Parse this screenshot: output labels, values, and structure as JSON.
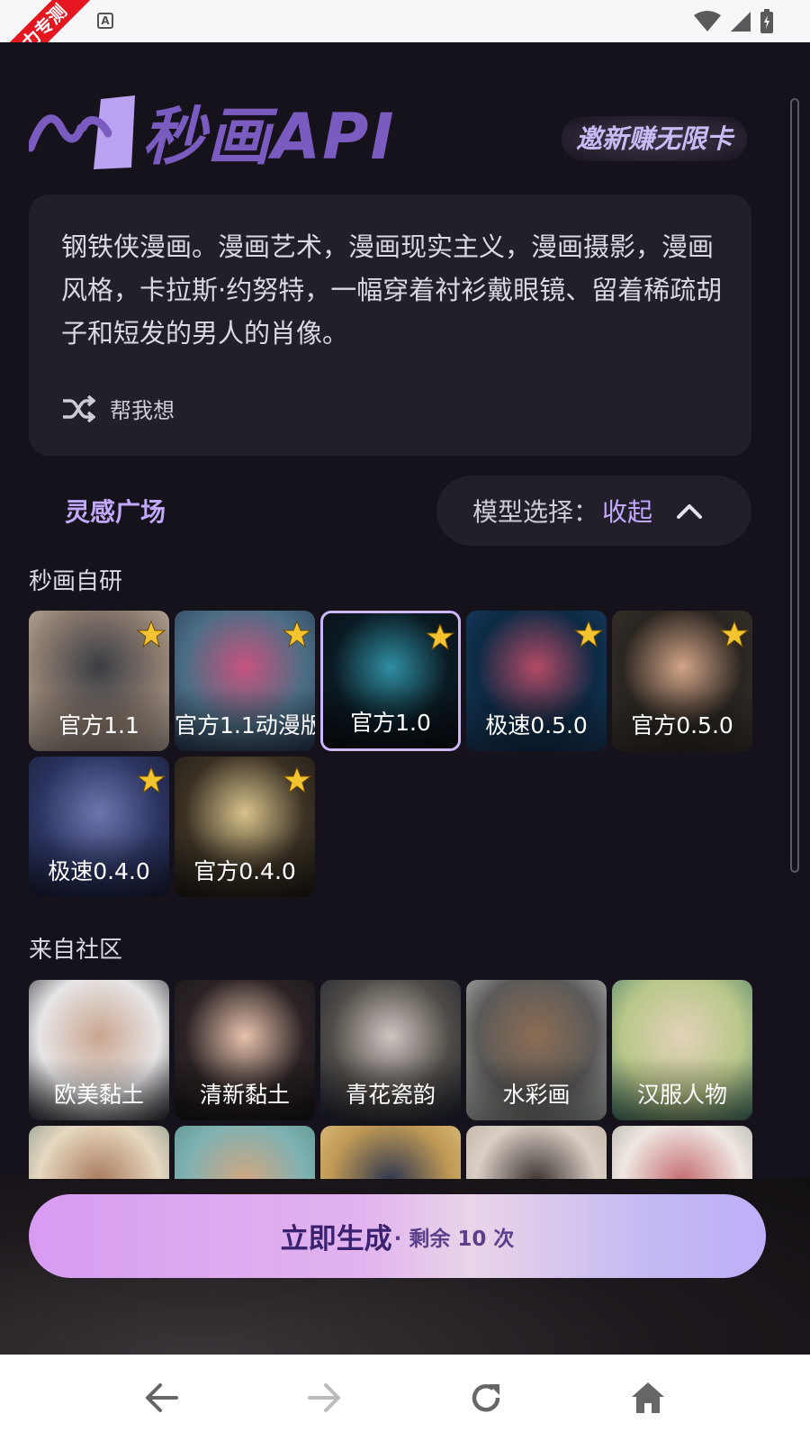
{
  "status_bar": {
    "ribbon": "圣力专测",
    "a_icon": "A"
  },
  "header": {
    "logo_text": "秒画API",
    "invite_label": "邀新赚无限卡"
  },
  "prompt": {
    "text": "钢铁侠漫画。漫画艺术，漫画现实主义，漫画摄影，漫画风格，卡拉斯·约努特，一幅穿着衬衫戴眼镜、留着稀疏胡子和短发的男人的肖像。",
    "help_label": "帮我想"
  },
  "inspiration_label": "灵感广场",
  "model_select": {
    "label": "模型选择：",
    "value": "收起"
  },
  "sections": {
    "official_title": "秒画自研",
    "community_title": "来自社区"
  },
  "official_models": [
    {
      "name": "官方1.1",
      "starred": true,
      "selected": false,
      "colors": [
        "#8a7a6e",
        "#3a3d44",
        "#c7b9a9"
      ]
    },
    {
      "name": "官方1.1动漫版",
      "starred": true,
      "selected": false,
      "colors": [
        "#4b6e85",
        "#c7537e",
        "#2b3a55"
      ]
    },
    {
      "name": "官方1.0",
      "starred": true,
      "selected": true,
      "colors": [
        "#0a1a22",
        "#2f8ea3",
        "#0d0d12"
      ]
    },
    {
      "name": "极速0.5.0",
      "starred": true,
      "selected": false,
      "colors": [
        "#0d2a45",
        "#b34a64",
        "#1a3f63"
      ]
    },
    {
      "name": "官方0.5.0",
      "starred": true,
      "selected": false,
      "colors": [
        "#2a2520",
        "#d2a487",
        "#3c3530"
      ]
    },
    {
      "name": "极速0.4.0",
      "starred": true,
      "selected": false,
      "colors": [
        "#2b3460",
        "#6f76b0",
        "#1a1e38"
      ]
    },
    {
      "name": "官方0.4.0",
      "starred": true,
      "selected": false,
      "colors": [
        "#3a3124",
        "#d9c38c",
        "#1f1a14"
      ]
    }
  ],
  "community_models": [
    {
      "name": "欧美黏土",
      "colors": [
        "#e7e5e6",
        "#caa690",
        "#2b2b35"
      ]
    },
    {
      "name": "清新黏土",
      "colors": [
        "#2a2224",
        "#e8c2ac",
        "#1b1618"
      ]
    },
    {
      "name": "青花瓷韵",
      "colors": [
        "#4f4a45",
        "#cfc6c2",
        "#202436"
      ]
    },
    {
      "name": "水彩画",
      "colors": [
        "#5b5a58",
        "#8c6d54",
        "#bfc3c2"
      ]
    },
    {
      "name": "汉服人物",
      "colors": [
        "#b9c78a",
        "#e2d2b8",
        "#4a7d6b"
      ]
    },
    {
      "name": "",
      "colors": [
        "#e6d8c0",
        "#a8785a",
        "#7d8e86"
      ]
    },
    {
      "name": "",
      "colors": [
        "#7fb1b3",
        "#d3a77f",
        "#568f82"
      ]
    },
    {
      "name": "",
      "colors": [
        "#c09a55",
        "#2c3550",
        "#e2c68a"
      ]
    },
    {
      "name": "",
      "colors": [
        "#d9cfc5",
        "#3a3130",
        "#b9a89b"
      ]
    },
    {
      "name": "",
      "colors": [
        "#efe7e2",
        "#c46a6f",
        "#a8a7a0"
      ]
    }
  ],
  "generate": {
    "main": "立即生成",
    "sub": "· 剩余 10 次"
  },
  "colors": {
    "accent": "#c2a9ff",
    "background": "#16121c",
    "card": "#231f2a",
    "star": "#f4c430"
  },
  "nav": [
    "back-icon",
    "forward-icon",
    "refresh-icon",
    "home-icon"
  ]
}
